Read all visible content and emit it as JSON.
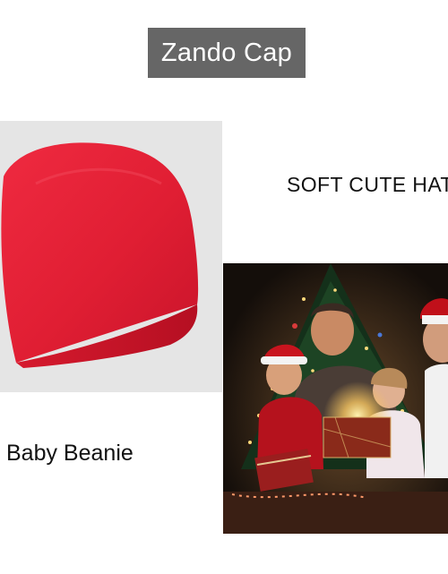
{
  "banner": {
    "brand_label": "Zando Cap"
  },
  "tagline": "SOFT CUTE HAT",
  "product_name": "Baby Beanie",
  "colors": {
    "badge_background": "#666666",
    "hat_panel_background": "#e5e5e5",
    "hat_red": "#e01e33",
    "photo_background": "#1a1410"
  },
  "images": {
    "hat_image": "red-beanie-image",
    "lifestyle_image": "family-christmas-photo"
  }
}
